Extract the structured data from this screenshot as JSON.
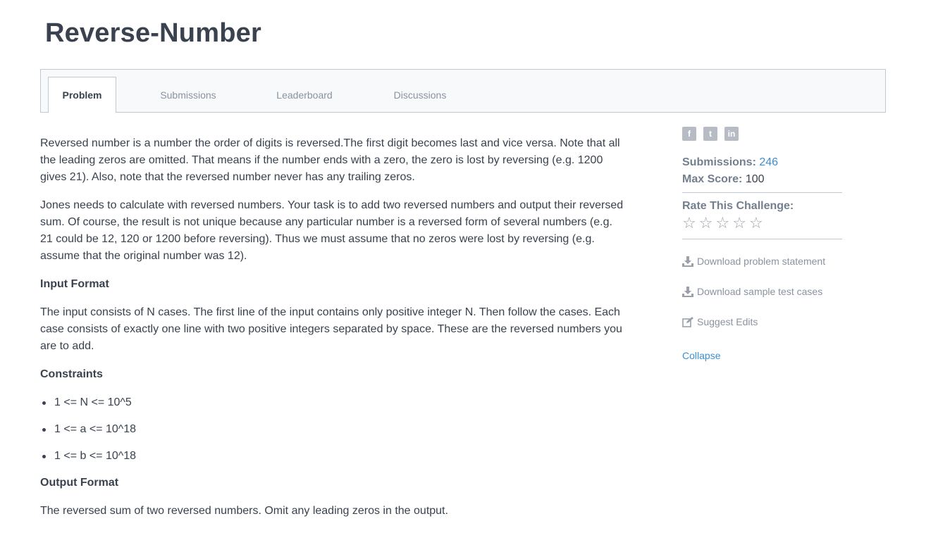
{
  "page": {
    "title": "Reverse-Number"
  },
  "tabs": [
    {
      "label": "Problem"
    },
    {
      "label": "Submissions"
    },
    {
      "label": "Leaderboard"
    },
    {
      "label": "Discussions"
    }
  ],
  "problem": {
    "paragraphs": [
      "Reversed number is a number the order of digits is reversed.The first digit becomes last and vice versa. Note that all the leading zeros are omitted. That means if the number ends with a zero, the zero is lost by reversing (e.g. 1200 gives 21). Also, note that the reversed number never has any trailing zeros.",
      "Jones needs to calculate with reversed numbers. Your task is to add two reversed numbers and output their reversed sum. Of course, the result is not unique because any particular number is a reversed form of several numbers (e.g. 21 could be 12, 120 or 1200 before reversing). Thus we must assume that no zeros were lost by reversing (e.g. assume that the original number was 12)."
    ],
    "input_heading": "Input Format",
    "input_text": "The input consists of N cases. The first line of the input contains only positive integer N. Then follow the cases. Each case consists of exactly one line with two positive integers separated by space. These are the reversed numbers you are to add.",
    "constraints_heading": "Constraints",
    "constraints": [
      "1 <= N <= 10^5",
      "1 <= a <= 10^18",
      "1 <= b <= 10^18"
    ],
    "output_heading": "Output Format",
    "output_text": "The reversed sum of two reversed numbers. Omit any leading zeros in the output."
  },
  "sidebar": {
    "social_icons": [
      "facebook-icon",
      "twitter-icon",
      "linkedin-icon"
    ],
    "social_glyphs": [
      "f",
      "t",
      "in"
    ],
    "submissions_label": "Submissions:",
    "submissions_value": "246",
    "max_score_label": "Max Score:",
    "max_score_value": "100",
    "rate_label": "Rate This Challenge:",
    "rating": 0,
    "download_statement": "Download problem statement",
    "download_tests": "Download sample test cases",
    "suggest_edits": "Suggest Edits",
    "collapse": "Collapse"
  },
  "colors": {
    "accent": "#3b8ed1",
    "text": "#39424e",
    "muted": "#8a93a0"
  }
}
